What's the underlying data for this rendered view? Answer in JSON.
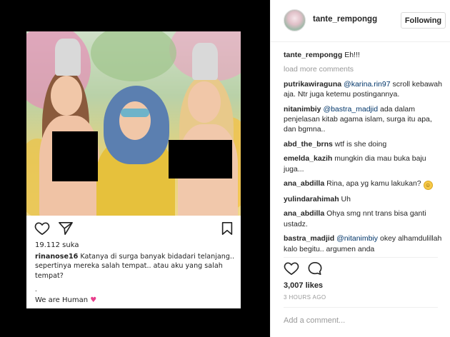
{
  "post": {
    "username": "tante_rempongg",
    "follow_label": "Following",
    "caption_user": "tante_rempongg",
    "caption_text": "Eh!!!",
    "load_more": "load more comments",
    "comments": [
      {
        "user": "putrikawiraguna",
        "mention": "@karina.rin97",
        "text": " scroll kebawah aja. Ntr juga ketemu postingannya."
      },
      {
        "user": "nitanimbiy",
        "mention": "@bastra_madjid",
        "text": " ada dalam penjelasan kitab agama islam, surga itu apa, dan bgmna.."
      },
      {
        "user": "abd_the_brns",
        "mention": "",
        "text": "wtf is she doing"
      },
      {
        "user": "emelda_kazih",
        "mention": "",
        "text": "mungkin dia mau buka baju juga..."
      },
      {
        "user": "ana_abdilla",
        "mention": "",
        "text": "Rina, apa yg kamu lakukan? "
      },
      {
        "user": "yulindarahimah",
        "mention": "",
        "text": "Uh"
      },
      {
        "user": "ana_abdilla",
        "mention": "",
        "text": "Ohya smg nnt trans bisa ganti ustadz."
      },
      {
        "user": "bastra_madjid",
        "mention": "@nitanimbiy",
        "text": " okey alhamdulillah kalo begitu.. argumen anda"
      }
    ],
    "likes": "3,007 likes",
    "time": "3 HOURS AGO",
    "add_comment_placeholder": "Add a comment..."
  },
  "inner_post": {
    "likes": "19.112 suka",
    "caption_user": "rinanose16",
    "caption_text": " Katanya di surga banyak bidadari telanjang.. sepertinya mereka salah tempat.. atau aku yang salah tempat?",
    "dot": ".",
    "footer": "We are Human",
    "heart": "♥"
  },
  "icons": {
    "heart": "heart-icon",
    "comment": "comment-icon",
    "share": "share-icon",
    "bookmark": "bookmark-icon",
    "emoji": "grinning-face-emoji"
  },
  "colors": {
    "link": "#003569",
    "muted": "#999999",
    "border": "#dbdbdb",
    "heart": "#e83e8c"
  }
}
